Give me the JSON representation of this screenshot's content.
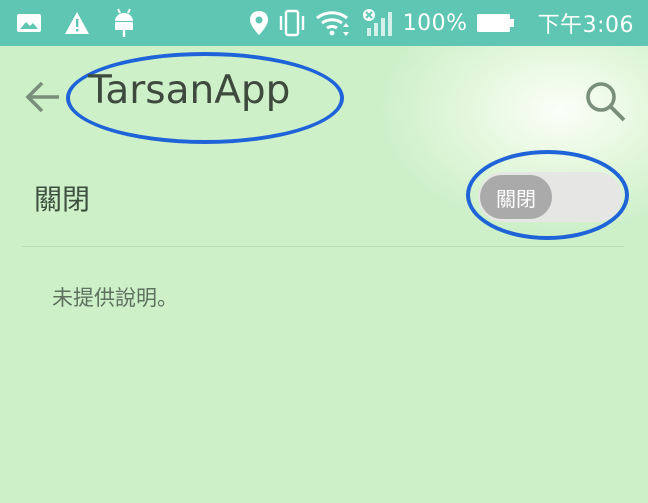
{
  "status_bar": {
    "left_icons": [
      "image-icon",
      "warning-icon",
      "android-icon"
    ],
    "right_icons": [
      "location-pin-icon",
      "vibrate-icon",
      "wifi-icon",
      "signal-no-sim-icon"
    ],
    "battery_percent": "100%",
    "battery_level": 1.0,
    "time": "下午3:06"
  },
  "app_bar": {
    "title": "TarsanApp",
    "back_icon": "arrow-back-icon",
    "search_icon": "search-icon"
  },
  "setting": {
    "label": "關閉",
    "toggle_label": "關閉",
    "toggle_on": false
  },
  "description": "未提供說明。",
  "colors": {
    "status_bar": "#5ec6b2",
    "annotation_ring": "#1f63d8",
    "background": "#cdf0c9",
    "toggle_track": "#e6e6e4",
    "toggle_knob": "#aaaaaa"
  }
}
